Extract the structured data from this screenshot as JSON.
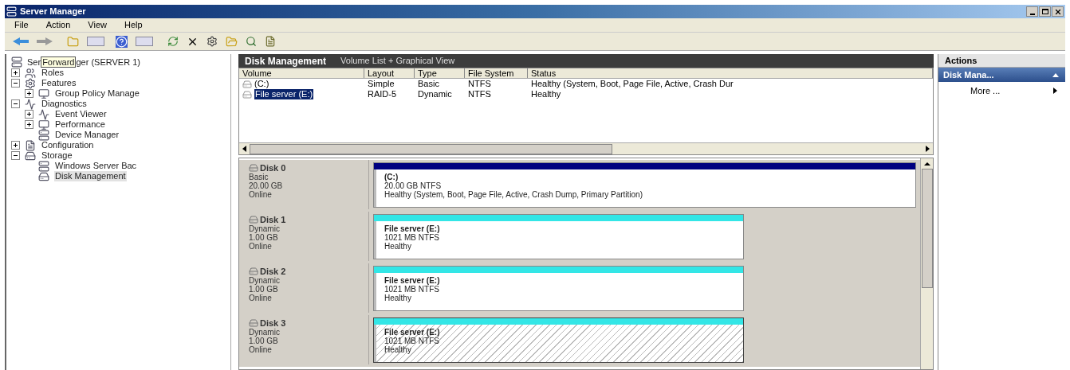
{
  "window": {
    "title": "Server Manager"
  },
  "menu": [
    "File",
    "Action",
    "View",
    "Help"
  ],
  "tooltip": "Forward",
  "tree": {
    "label_start": "Ser",
    "label_end": "ger (SERVER 1)",
    "children": [
      {
        "label": "Roles",
        "expanded": false,
        "selected": false
      },
      {
        "label": "Features",
        "expanded": true,
        "selected": false,
        "children": [
          {
            "label": "Group Policy Manage",
            "expanded": false,
            "selected": false
          }
        ]
      },
      {
        "label": "Diagnostics",
        "expanded": true,
        "selected": false,
        "children": [
          {
            "label": "Event Viewer",
            "expanded": false,
            "selected": false
          },
          {
            "label": "Performance",
            "expanded": false,
            "selected": false
          },
          {
            "label": "Device Manager",
            "selected": false
          }
        ]
      },
      {
        "label": "Configuration",
        "expanded": false,
        "selected": false
      },
      {
        "label": "Storage",
        "expanded": true,
        "selected": false,
        "children": [
          {
            "label": "Windows Server Bac",
            "selected": false
          },
          {
            "label": "Disk Management",
            "selected": true
          }
        ]
      }
    ]
  },
  "center": {
    "title": "Disk Management",
    "subtitle": "Volume List + Graphical View"
  },
  "table": {
    "columns": [
      "Volume",
      "Layout",
      "Type",
      "File System",
      "Status"
    ],
    "rows": [
      {
        "cells": [
          "(C:)",
          "Simple",
          "Basic",
          "NTFS",
          "Healthy (System, Boot, Page File, Active, Crash Dur"
        ],
        "selected": false
      },
      {
        "cells": [
          "File server (E:)",
          "RAID-5",
          "Dynamic",
          "NTFS",
          "Healthy"
        ],
        "selected": true
      }
    ]
  },
  "disks": [
    {
      "name": "Disk 0",
      "type": "Basic",
      "size": "20.00 GB",
      "state": "Online",
      "partition": {
        "name": "(C:)",
        "size": "20.00 GB NTFS",
        "status": "Healthy (System, Boot, Page File, Active, Crash Dump, Primary Partition)",
        "color": "#000080",
        "kind": "wide",
        "selected": false
      }
    },
    {
      "name": "Disk 1",
      "type": "Dynamic",
      "size": "1.00 GB",
      "state": "Online",
      "partition": {
        "name": "File server  (E:)",
        "size": "1021 MB NTFS",
        "status": "Healthy",
        "color": "#33e6e6",
        "kind": "narrow",
        "selected": false
      }
    },
    {
      "name": "Disk 2",
      "type": "Dynamic",
      "size": "1.00 GB",
      "state": "Online",
      "partition": {
        "name": "File server  (E:)",
        "size": "1021 MB NTFS",
        "status": "Healthy",
        "color": "#33e6e6",
        "kind": "narrow",
        "selected": false
      }
    },
    {
      "name": "Disk 3",
      "type": "Dynamic",
      "size": "1.00 GB",
      "state": "Online",
      "partition": {
        "name": "File server  (E:)",
        "size": "1021 MB NTFS",
        "status": "Healthy",
        "color": "#33e6e6",
        "kind": "narrow",
        "selected": true
      }
    }
  ],
  "actions": {
    "title": "Actions",
    "section": "Disk Mana...",
    "expanded": true,
    "items": [
      "More ..."
    ]
  }
}
